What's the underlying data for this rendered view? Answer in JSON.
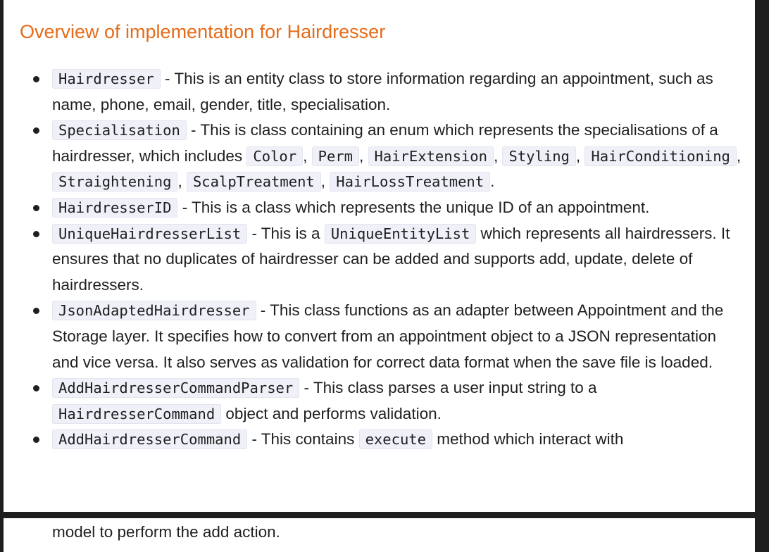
{
  "title": "Overview of implementation for Hairdresser",
  "items": [
    {
      "code1": "Hairdresser",
      "text1": " - This is an entity class to store information regarding an appointment, such as name, phone, email, gender, title, specialisation."
    },
    {
      "code1": "Specialisation",
      "text1": " - This is class containing an enum which represents the specialisations of a hairdresser, which includes ",
      "enum_values": [
        "Color",
        "Perm",
        "HairExtension",
        "Styling",
        "HairConditioning",
        "Straightening",
        "ScalpTreatment",
        "HairLossTreatment"
      ],
      "sep": ", ",
      "end": "."
    },
    {
      "code1": "HairdresserID",
      "text1": " - This is a class which represents the unique ID of an appointment."
    },
    {
      "code1": "UniqueHairdresserList",
      "text1": " - This is a ",
      "code2": "UniqueEntityList",
      "text2": " which represents all hairdressers. It ensures that no duplicates of hairdresser can be added and supports add, update, delete of hairdressers."
    },
    {
      "code1": "JsonAdaptedHairdresser",
      "text1": " - This class functions as an adapter between Appointment and the Storage layer. It specifies how to convert from an appointment object to a JSON representation and vice versa. It also serves as validation for correct data format when the save file is loaded."
    },
    {
      "code1": "AddHairdresserCommandParser",
      "text1": " - This class parses a user input string to a ",
      "code2": "HairdresserCommand",
      "text2": " object and performs validation."
    },
    {
      "code1": "AddHairdresserCommand",
      "text1": " - This contains ",
      "code2": "execute",
      "text2": " method which interact with"
    }
  ],
  "continuation": "model to perform the add action.",
  "colors": {
    "heading": "#e46c1a",
    "code_bg": "#eff0f8",
    "frame": "#1f1f1f"
  }
}
